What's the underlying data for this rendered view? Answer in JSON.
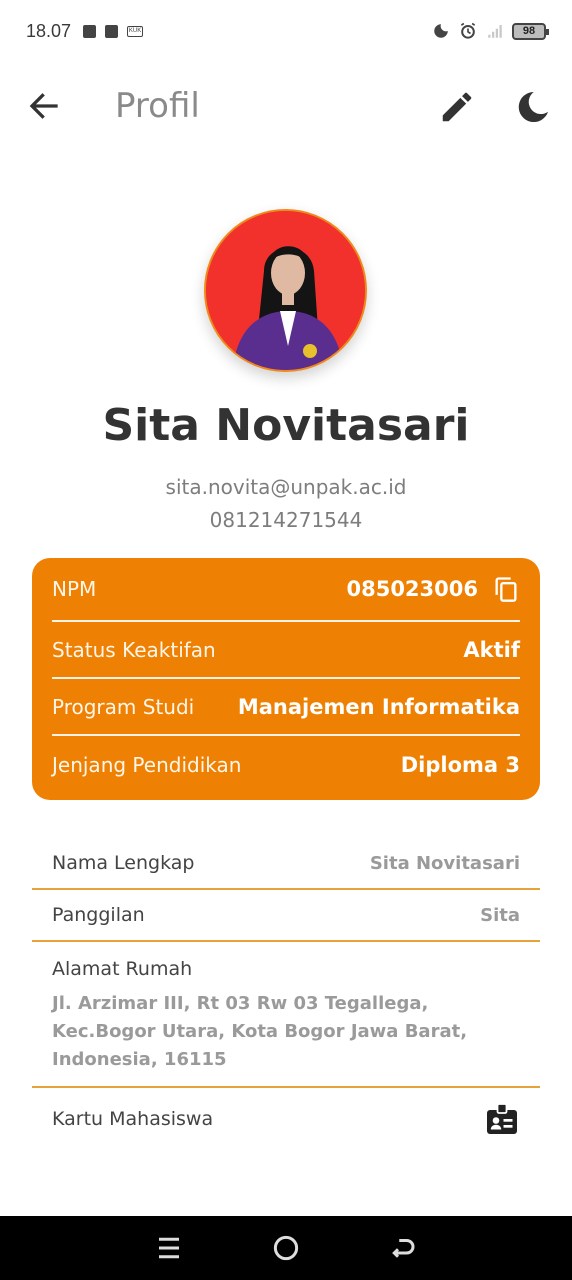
{
  "status_bar": {
    "time": "18.07",
    "battery": "98",
    "icons": [
      "notification-icon",
      "facebook-icon",
      "kuk-icon",
      "moon-icon",
      "alarm-icon",
      "signal-icon"
    ],
    "small_icon_text": "KUK"
  },
  "app_bar": {
    "title": "Profil",
    "icons": [
      "back-arrow-icon",
      "pencil-icon",
      "moon-icon"
    ]
  },
  "profile": {
    "name": "Sita Novitasari",
    "email": "sita.novita@unpak.ac.id",
    "phone": "081214271544"
  },
  "info_card": {
    "rows": [
      {
        "label": "NPM",
        "value": "085023006"
      },
      {
        "label": "Status Keaktifan",
        "value": "Aktif"
      },
      {
        "label": "Program Studi",
        "value": "Manajemen Informatika"
      },
      {
        "label": "Jenjang Pendidikan",
        "value": "Diploma 3"
      }
    ]
  },
  "details": {
    "full_name": {
      "label": "Nama Lengkap",
      "value": "Sita Novitasari"
    },
    "nickname": {
      "label": "Panggilan",
      "value": "Sita"
    },
    "address": {
      "label": "Alamat Rumah",
      "value": "Jl. Arzimar III, Rt 03 Rw 03 Tegallega, Kec.Bogor Utara, Kota Bogor Jawa Barat, Indonesia, 16115"
    },
    "student_card": {
      "label": "Kartu Mahasiswa"
    }
  },
  "colors": {
    "accent": "#ee8103",
    "avatar_bg": "#f2312d",
    "divider": "#e8a23c"
  }
}
